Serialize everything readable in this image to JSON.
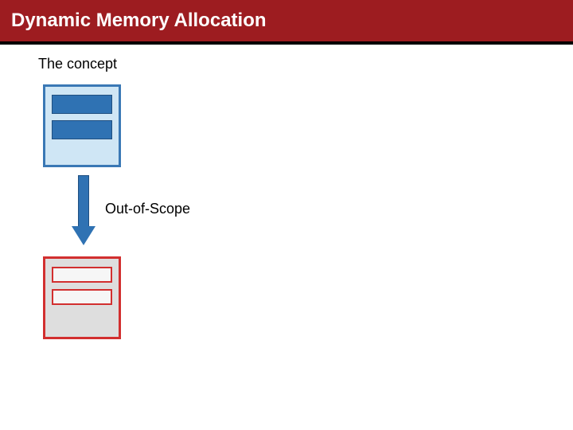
{
  "header": {
    "title": "Dynamic Memory Allocation"
  },
  "subtitle": "The concept",
  "arrow_label": "Out-of-Scope",
  "colors": {
    "header_bg": "#9d1c20",
    "in_scope_border": "#3a78b5",
    "in_scope_fill": "#cfe6f5",
    "in_scope_slot": "#2f72b3",
    "out_scope_border": "#d22f2f",
    "out_scope_fill": "#dedede",
    "out_scope_slot_fill": "#f6f6f6"
  },
  "diagram": {
    "top_box": {
      "state": "in-scope",
      "slots": 2
    },
    "bottom_box": {
      "state": "out-of-scope",
      "slots": 2
    },
    "transition": "arrow-down"
  }
}
